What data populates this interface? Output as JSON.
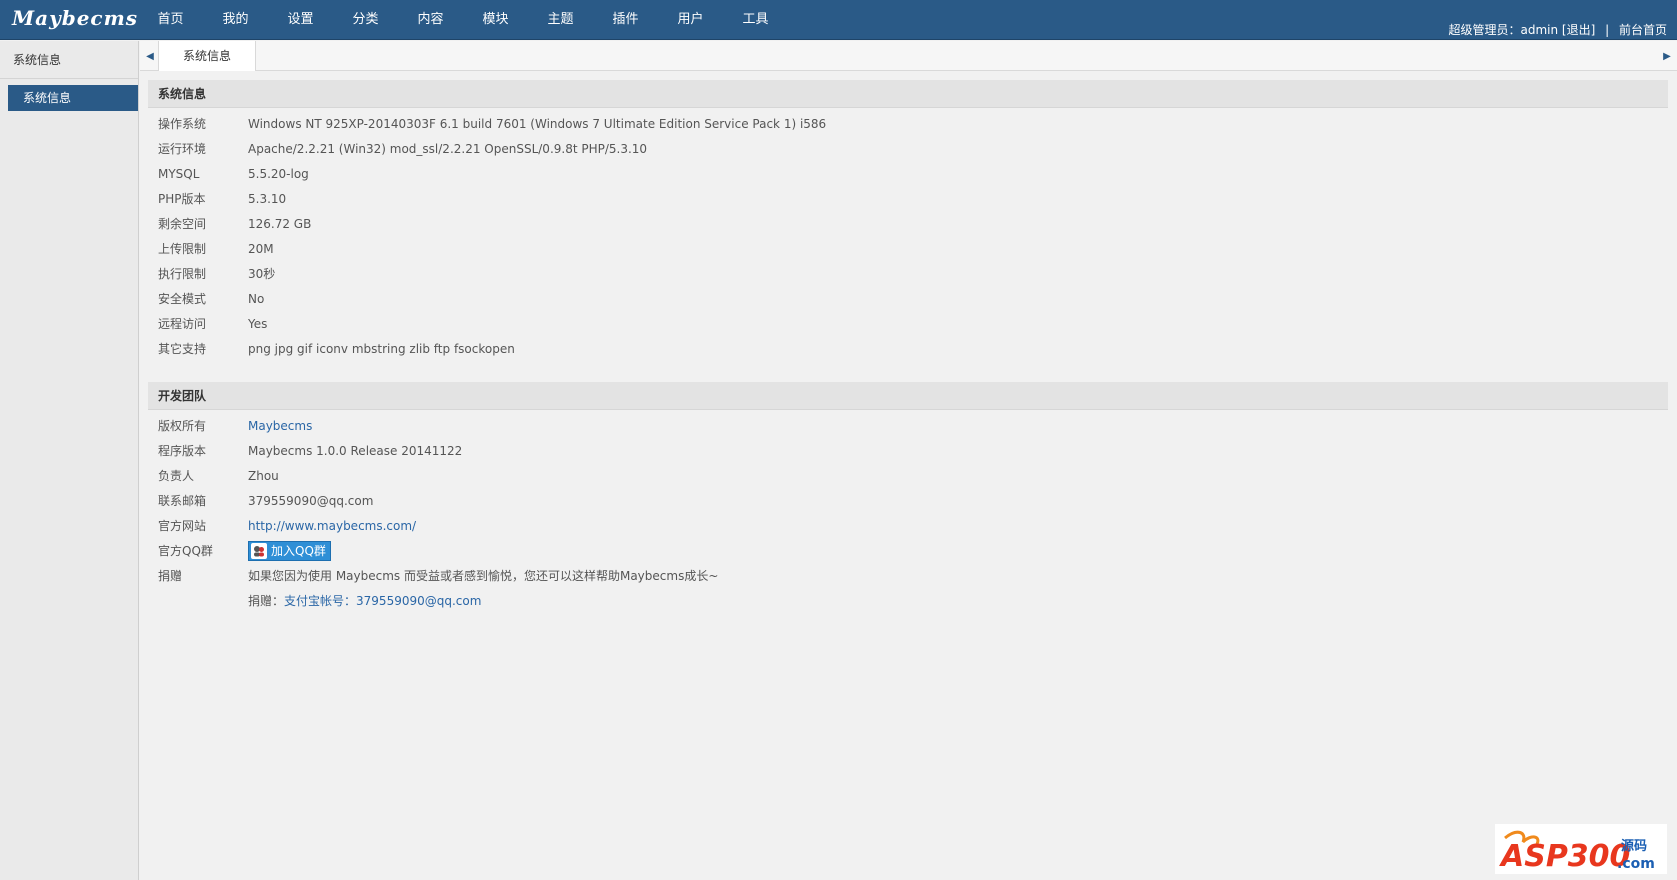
{
  "header": {
    "logo": "Maybecms",
    "nav": [
      "首页",
      "我的",
      "设置",
      "分类",
      "内容",
      "模块",
      "主题",
      "插件",
      "用户",
      "工具"
    ],
    "user_label": "超级管理员：admin",
    "logout": "[退出]",
    "separator": "|",
    "front_home": "前台首页"
  },
  "sidebar": {
    "title": "系统信息",
    "items": [
      {
        "label": "系统信息"
      }
    ]
  },
  "tabs": [
    {
      "label": "系统信息"
    }
  ],
  "sections": {
    "system": {
      "title": "系统信息",
      "rows": [
        {
          "label": "操作系统",
          "value": "Windows NT 925XP-20140303F 6.1 build 7601 (Windows 7 Ultimate Edition Service Pack 1) i586"
        },
        {
          "label": "运行环境",
          "value": "Apache/2.2.21 (Win32) mod_ssl/2.2.21 OpenSSL/0.9.8t PHP/5.3.10"
        },
        {
          "label": "MYSQL",
          "value": "5.5.20-log"
        },
        {
          "label": "PHP版本",
          "value": "5.3.10"
        },
        {
          "label": "剩余空间",
          "value": "126.72 GB"
        },
        {
          "label": "上传限制",
          "value": "20M"
        },
        {
          "label": "执行限制",
          "value": "30秒"
        },
        {
          "label": "安全模式",
          "value": "No"
        },
        {
          "label": "远程访问",
          "value": "Yes"
        },
        {
          "label": "其它支持",
          "value": "png jpg gif iconv mbstring zlib ftp fsockopen"
        }
      ]
    },
    "team": {
      "title": "开发团队",
      "copyright_label": "版权所有",
      "copyright_value": "Maybecms",
      "version_label": "程序版本",
      "version_value": "Maybecms 1.0.0 Release 20141122",
      "owner_label": "负责人",
      "owner_value": "Zhou",
      "email_label": "联系邮箱",
      "email_value": "379559090@qq.com",
      "site_label": "官方网站",
      "site_value": "http://www.maybecms.com/",
      "qq_label": "官方QQ群",
      "qq_button": "加入QQ群",
      "donate_label": "捐赠",
      "donate_text": "如果您因为使用 Maybecms 而受益或者感到愉悦，您还可以这样帮助Maybecms成长~",
      "donate_prefix": "捐赠：",
      "donate_alipay": "支付宝帐号：",
      "donate_account": "379559090@qq.com"
    }
  },
  "watermark": {
    "text": "ASP300",
    "suffix": ".com",
    "cn": "源码"
  },
  "colors": {
    "header": "#2a5a87",
    "link": "#2a66a6",
    "qq_button": "#2f8fd6"
  }
}
